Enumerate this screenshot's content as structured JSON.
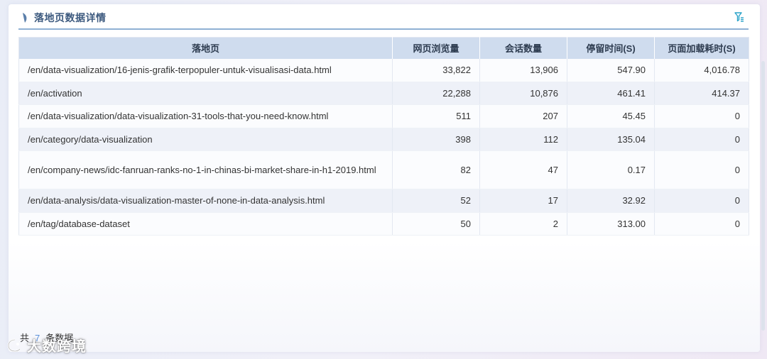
{
  "panel": {
    "title": "落地页数据详情",
    "filter_icon": "filter-icon"
  },
  "table": {
    "columns": [
      "落地页",
      "网页浏览量",
      "会话数量",
      "停留时间(S)",
      "页面加载耗时(S)"
    ],
    "rows": [
      {
        "url": "/en/data-visualization/16-jenis-grafik-terpopuler-untuk-visualisasi-data.html",
        "views": "33,822",
        "sessions": "13,906",
        "stay": "547.90",
        "load": "4,016.78"
      },
      {
        "url": "/en/activation",
        "views": "22,288",
        "sessions": "10,876",
        "stay": "461.41",
        "load": "414.37"
      },
      {
        "url": "/en/data-visualization/data-visualization-31-tools-that-you-need-know.html",
        "views": "511",
        "sessions": "207",
        "stay": "45.45",
        "load": "0"
      },
      {
        "url": "/en/category/data-visualization",
        "views": "398",
        "sessions": "112",
        "stay": "135.04",
        "load": "0"
      },
      {
        "url": "/en/company-news/idc-fanruan-ranks-no-1-in-chinas-bi-market-share-in-h1-2019.html",
        "views": "82",
        "sessions": "47",
        "stay": "0.17",
        "load": "0"
      },
      {
        "url": "/en/data-analysis/data-visualization-master-of-none-in-data-analysis.html",
        "views": "52",
        "sessions": "17",
        "stay": "32.92",
        "load": "0"
      },
      {
        "url": "/en/tag/database-dataset",
        "views": "50",
        "sessions": "2",
        "stay": "313.00",
        "load": "0"
      }
    ]
  },
  "footer": {
    "prefix": "共",
    "count": "7",
    "suffix": "条数据"
  },
  "watermark": {
    "text": "大数跨境"
  },
  "colors": {
    "header_bg": "#cfdcee",
    "title": "#3d5a7f",
    "accent": "#2aa3c9",
    "count": "#5a8fd8"
  }
}
